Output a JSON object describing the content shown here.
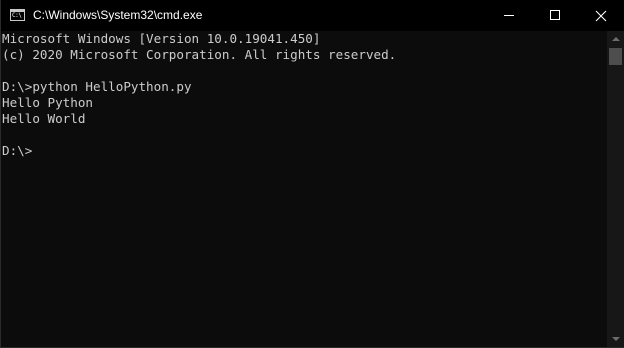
{
  "window": {
    "title": "C:\\Windows\\System32\\cmd.exe",
    "app_icon_text": "C:\\"
  },
  "console": {
    "lines": [
      "Microsoft Windows [Version 10.0.19041.450]",
      "(c) 2020 Microsoft Corporation. All rights reserved.",
      "",
      "D:\\>python HelloPython.py",
      "Hello Python",
      "Hello World",
      "",
      "D:\\>"
    ]
  },
  "colors": {
    "background": "#0c0c0c",
    "text": "#cccccc",
    "titlebar": "#000000"
  }
}
